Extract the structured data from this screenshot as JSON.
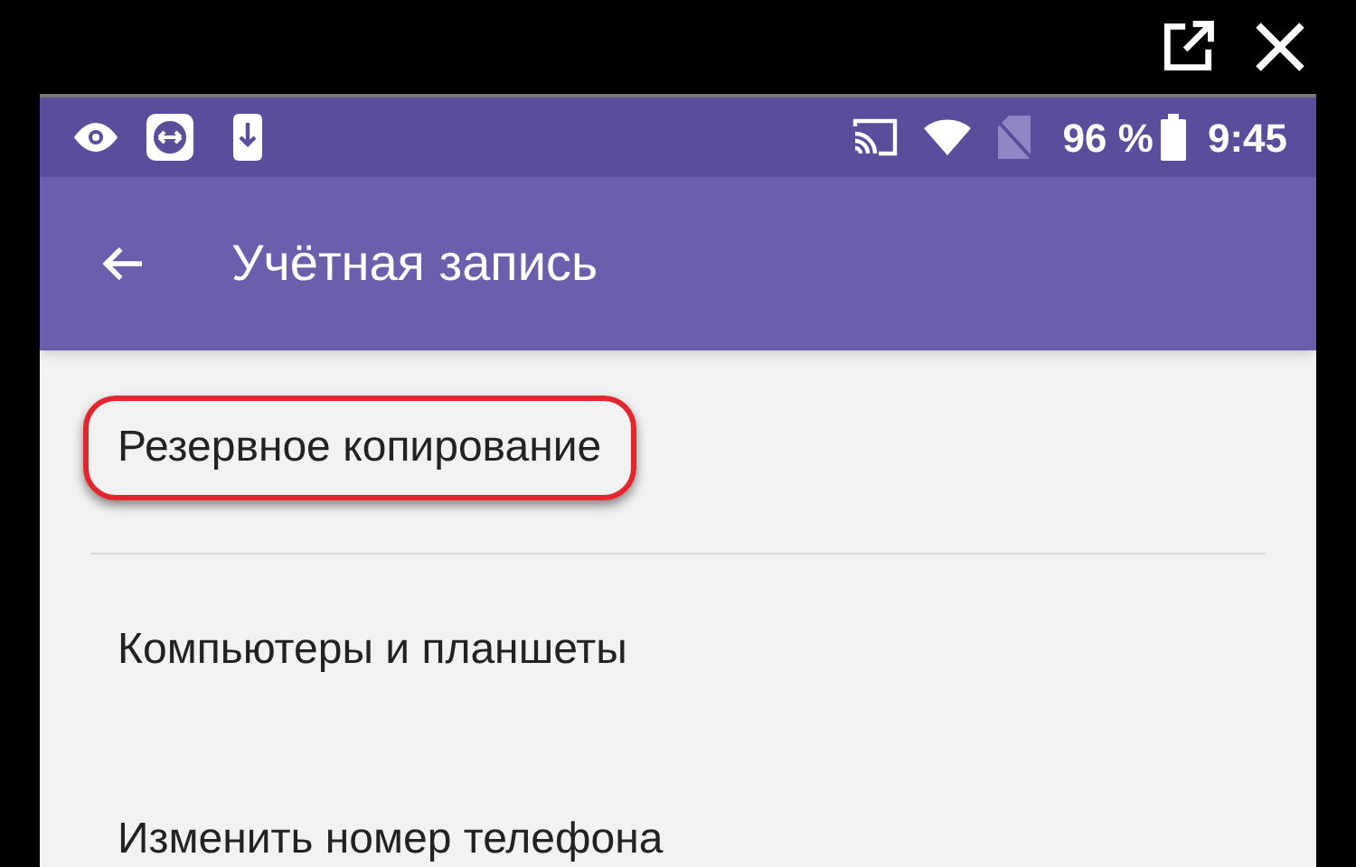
{
  "status_bar": {
    "battery_percent": "96 %",
    "time": "9:45"
  },
  "app_bar": {
    "title": "Учётная запись"
  },
  "items": [
    {
      "label": "Резервное копирование",
      "highlighted": true
    },
    {
      "label": "Компьютеры и планшеты",
      "highlighted": false
    },
    {
      "label": "Изменить номер телефона",
      "highlighted": false
    }
  ]
}
